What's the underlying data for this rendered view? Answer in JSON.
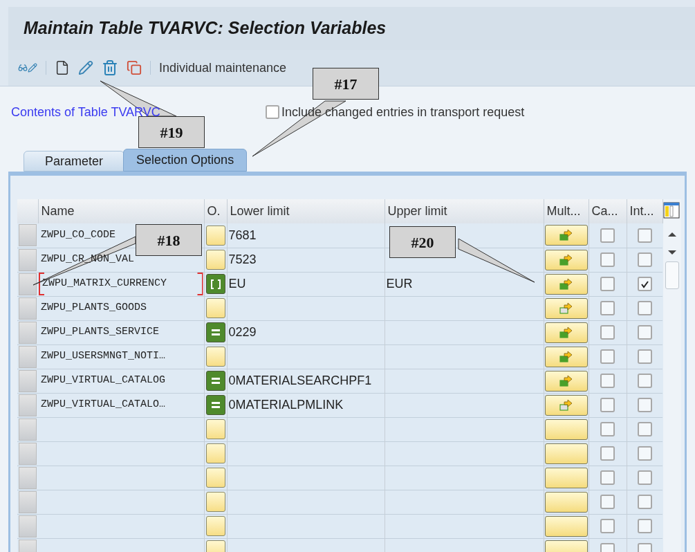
{
  "window": {
    "title": "Maintain Table TVARVC: Selection Variables"
  },
  "toolbar": {
    "label": "Individual maintenance"
  },
  "link": "Contents of Table TVARVC",
  "transport_checkbox": {
    "label": "Include changed entries in transport request",
    "checked": false
  },
  "tabs": [
    {
      "label": "Parameter",
      "selected": false
    },
    {
      "label": "Selection Options",
      "selected": true
    }
  ],
  "table": {
    "columns": [
      "Name",
      "O.",
      "Lower limit",
      "Upper limit",
      "Mult...",
      "Ca...",
      "Int..."
    ],
    "rows": [
      {
        "name": "ZWPU_CO_CODE",
        "option": {
          "kind": "empty"
        },
        "low": "7681",
        "high": "",
        "multi": {
          "kind": "filled"
        },
        "ca": false,
        "int": false,
        "focused": false
      },
      {
        "name": "ZWPU_CR_NON_VAL",
        "option": {
          "kind": "empty"
        },
        "low": "7523",
        "high": "",
        "multi": {
          "kind": "filled"
        },
        "ca": false,
        "int": false,
        "focused": false
      },
      {
        "name": "ZWPU_MATRIX_CURRENCY",
        "option": {
          "kind": "between"
        },
        "low": "EU",
        "high": "EUR",
        "multi": {
          "kind": "filled"
        },
        "ca": false,
        "int": true,
        "focused": true
      },
      {
        "name": "ZWPU_PLANTS_GOODS",
        "option": {
          "kind": "empty"
        },
        "low": "",
        "high": "",
        "multi": {
          "kind": "outline"
        },
        "ca": false,
        "int": false,
        "focused": false
      },
      {
        "name": "ZWPU_PLANTS_SERVICE",
        "option": {
          "kind": "equal"
        },
        "low": "0229",
        "high": "",
        "multi": {
          "kind": "filled"
        },
        "ca": false,
        "int": false,
        "focused": false
      },
      {
        "name": "ZWPU_USERSMNGT_NOTI…",
        "option": {
          "kind": "empty"
        },
        "low": "",
        "high": "",
        "multi": {
          "kind": "filled"
        },
        "ca": false,
        "int": false,
        "focused": false
      },
      {
        "name": "ZWPU_VIRTUAL_CATALOG",
        "option": {
          "kind": "equal"
        },
        "low": "0MATERIALSEARCHPF1",
        "high": "",
        "multi": {
          "kind": "filled"
        },
        "ca": false,
        "int": false,
        "focused": false
      },
      {
        "name": "ZWPU_VIRTUAL_CATALO…",
        "option": {
          "kind": "equal"
        },
        "low": "0MATERIALPMLINK",
        "high": "",
        "multi": {
          "kind": "outline"
        },
        "ca": false,
        "int": false,
        "focused": false
      },
      {
        "name": "",
        "option": {
          "kind": "empty"
        },
        "low": "",
        "high": "",
        "multi": {
          "kind": "none"
        },
        "ca": false,
        "int": false,
        "focused": false
      },
      {
        "name": "",
        "option": {
          "kind": "empty"
        },
        "low": "",
        "high": "",
        "multi": {
          "kind": "none"
        },
        "ca": false,
        "int": false,
        "focused": false
      },
      {
        "name": "",
        "option": {
          "kind": "empty"
        },
        "low": "",
        "high": "",
        "multi": {
          "kind": "none"
        },
        "ca": false,
        "int": false,
        "focused": false
      },
      {
        "name": "",
        "option": {
          "kind": "empty"
        },
        "low": "",
        "high": "",
        "multi": {
          "kind": "none"
        },
        "ca": false,
        "int": false,
        "focused": false
      },
      {
        "name": "",
        "option": {
          "kind": "empty"
        },
        "low": "",
        "high": "",
        "multi": {
          "kind": "none"
        },
        "ca": false,
        "int": false,
        "focused": false
      },
      {
        "name": "",
        "option": {
          "kind": "empty"
        },
        "low": "",
        "high": "",
        "multi": {
          "kind": "none"
        },
        "ca": false,
        "int": false,
        "focused": false
      }
    ]
  },
  "callouts": [
    {
      "label": "#19",
      "kind": "up-left"
    },
    {
      "label": "#17",
      "kind": "down-left"
    },
    {
      "label": "#18",
      "kind": "down-left-far"
    },
    {
      "label": "#20",
      "kind": "down-right"
    }
  ]
}
